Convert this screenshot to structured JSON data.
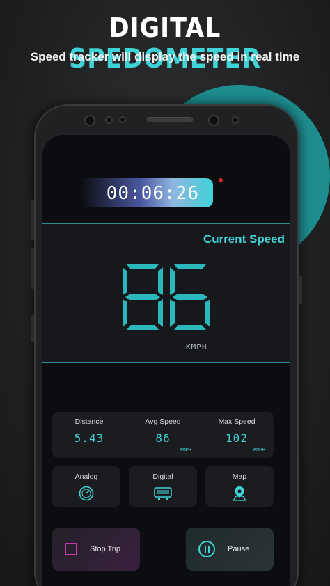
{
  "promo": {
    "title_part1": "DIGITAL",
    "title_part2": "SPEDOMETER",
    "subtitle": "Speed tracker will display the speed in real time"
  },
  "app": {
    "timer": "00:06:26",
    "current_speed_label": "Current Speed",
    "current_speed_value": "86",
    "current_speed_unit": "KMPH",
    "stats": [
      {
        "label": "Distance",
        "value": "5.43",
        "unit": ""
      },
      {
        "label": "Avg Speed",
        "value": "86",
        "unit": "KMPH"
      },
      {
        "label": "Max Speed",
        "value": "102",
        "unit": "KMPH"
      }
    ],
    "modes": [
      {
        "label": "Analog",
        "icon": "speedometer-icon"
      },
      {
        "label": "Digital",
        "icon": "digital-display-icon"
      },
      {
        "label": "Map",
        "icon": "map-pin-icon"
      }
    ],
    "actions": {
      "stop_label": "Stop Trip",
      "pause_label": "Pause"
    }
  },
  "colors": {
    "accent": "#3fd2d6",
    "circle": "#1e8d8f",
    "record_dot": "#e02828",
    "stop_accent": "#c43aa3"
  }
}
